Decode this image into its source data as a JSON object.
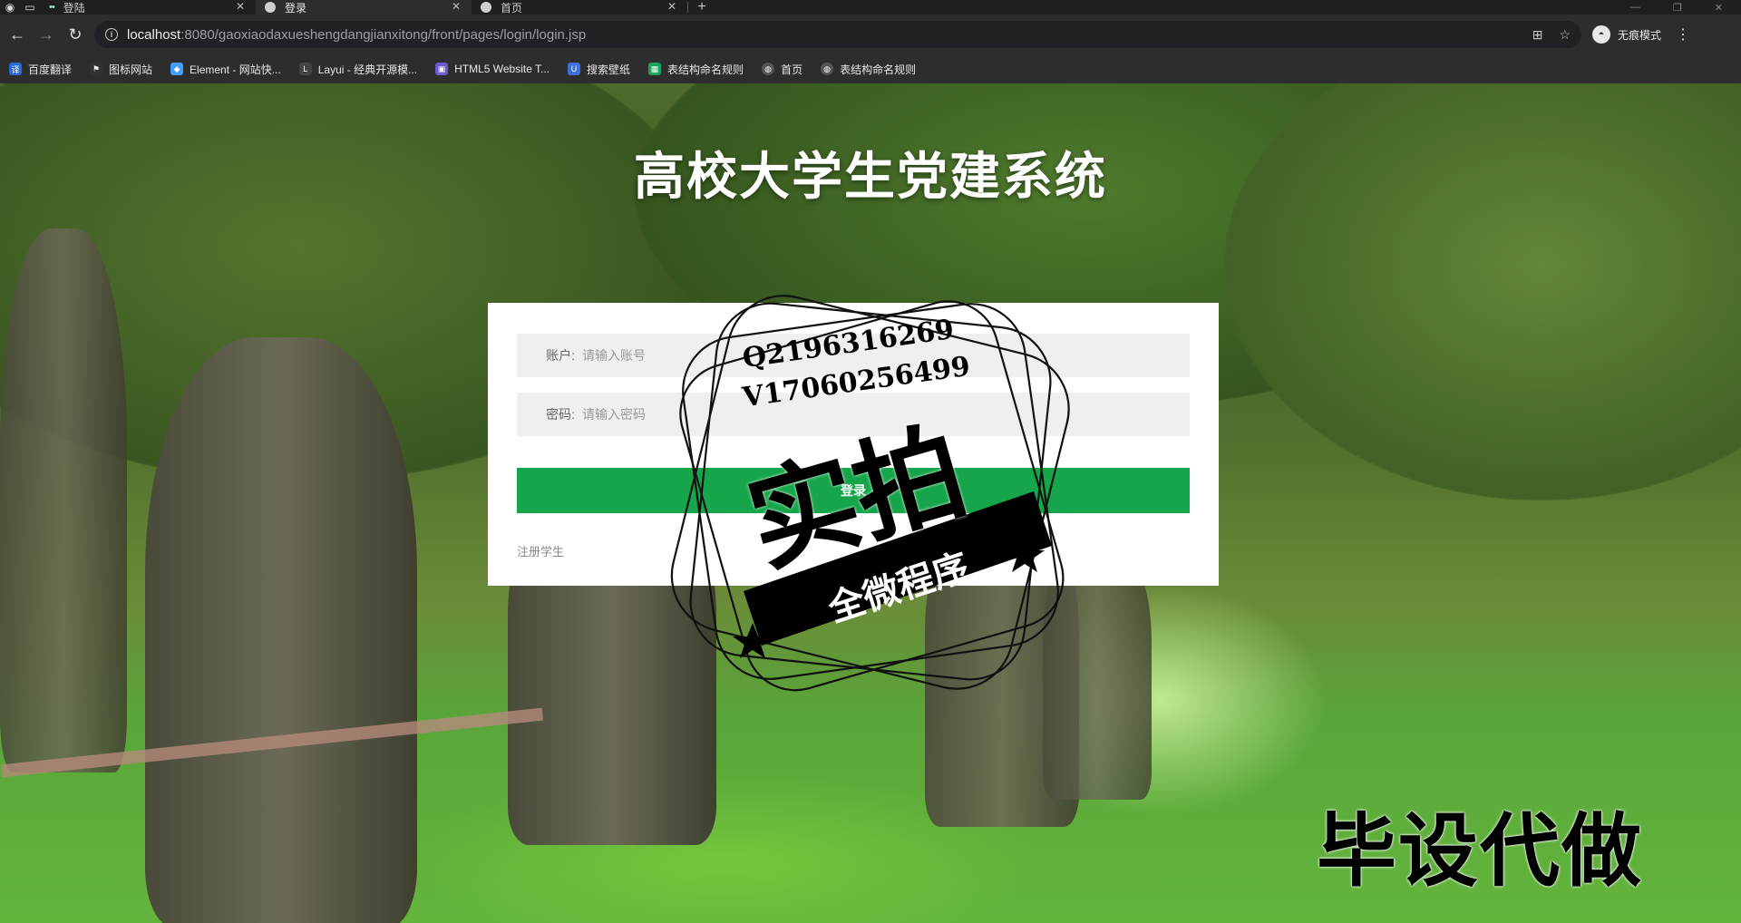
{
  "browser": {
    "tabs": [
      {
        "title": "登陆",
        "active": false,
        "icon": "dots-favicon-icon"
      },
      {
        "title": "登录",
        "active": true,
        "icon": "globe-favicon-icon"
      },
      {
        "title": "首页",
        "active": false,
        "icon": "globe-favicon-icon"
      }
    ],
    "url_host": "localhost",
    "url_path": ":8080/gaoxiaodaxueshengdangjianxitong/front/pages/login/login.jsp",
    "profile_label": "无痕模式",
    "bookmarks": [
      {
        "label": "百度翻译",
        "color": "#2a6ad8",
        "icon": "translate-icon"
      },
      {
        "label": "图标网站",
        "color": "#333333",
        "icon": "flag-icon"
      },
      {
        "label": "Element - 网站快...",
        "color": "#409eff",
        "icon": "element-icon"
      },
      {
        "label": "Layui - 经典开源模...",
        "color": "#444444",
        "icon": "layui-icon"
      },
      {
        "label": "HTML5 Website T...",
        "color": "#6a5acd",
        "icon": "html5-icon"
      },
      {
        "label": "搜索壁纸",
        "color": "#3f6fd8",
        "icon": "wallpaper-icon"
      },
      {
        "label": "表结构命名规则",
        "color": "#1aa260",
        "icon": "sheet-icon"
      },
      {
        "label": "首页",
        "color": "#555555",
        "icon": "globe-icon"
      },
      {
        "label": "表结构命名规则",
        "color": "#555555",
        "icon": "globe-icon"
      }
    ]
  },
  "page": {
    "title": "高校大学生党建系统",
    "account_label": "账户:",
    "account_placeholder": "请输入账号",
    "password_label": "密码:",
    "password_placeholder": "请输入密码",
    "login_button": "登录",
    "register_link": "注册学生"
  },
  "watermark": {
    "line1": "Q2196316269",
    "line2": "V17060256499",
    "big_text": "实拍",
    "banner_text": "全微程序",
    "corner_text": "毕设代做"
  },
  "colors": {
    "accent": "#16a54a",
    "field_bg": "#f0eeef"
  }
}
